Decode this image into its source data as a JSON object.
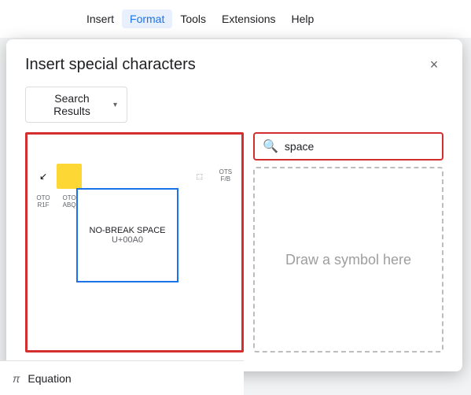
{
  "menuBar": {
    "items": [
      {
        "label": "Insert",
        "active": false
      },
      {
        "label": "Format",
        "active": true
      },
      {
        "label": "Tools",
        "active": false
      },
      {
        "label": "Extensions",
        "active": false
      },
      {
        "label": "Help",
        "active": false
      }
    ]
  },
  "dialog": {
    "title": "Insert special characters",
    "close_label": "×",
    "dropdown": {
      "label": "Search Results",
      "arrow": "▾"
    },
    "selectedChar": {
      "name": "NO-BREAK SPACE",
      "code": "U+00A0"
    },
    "search": {
      "value": "space",
      "placeholder": "Search"
    },
    "drawArea": {
      "hint": "Draw a symbol here"
    }
  },
  "equationBar": {
    "icon": "π",
    "label": "Equation"
  }
}
